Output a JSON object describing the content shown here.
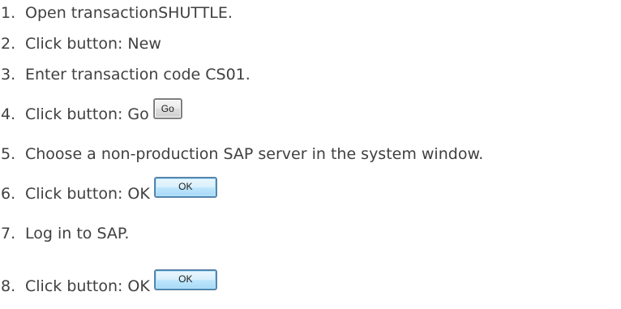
{
  "steps": [
    {
      "number": "1.",
      "text": "Open transactionSHUTTLE."
    },
    {
      "number": "2.",
      "text": "Click button: New"
    },
    {
      "number": "3.",
      "text": "Enter transaction code CS01."
    },
    {
      "number": "4.",
      "text": "Click button: Go",
      "button_label": "Go"
    },
    {
      "number": "5.",
      "text": "Choose a non-production SAP server in the system window."
    },
    {
      "number": "6.",
      "text": "Click button: OK",
      "button_label": "OK"
    },
    {
      "number": "7.",
      "text": "Log in to SAP."
    },
    {
      "number": "8.",
      "text": "Click button: OK",
      "button_label": "OK"
    }
  ]
}
